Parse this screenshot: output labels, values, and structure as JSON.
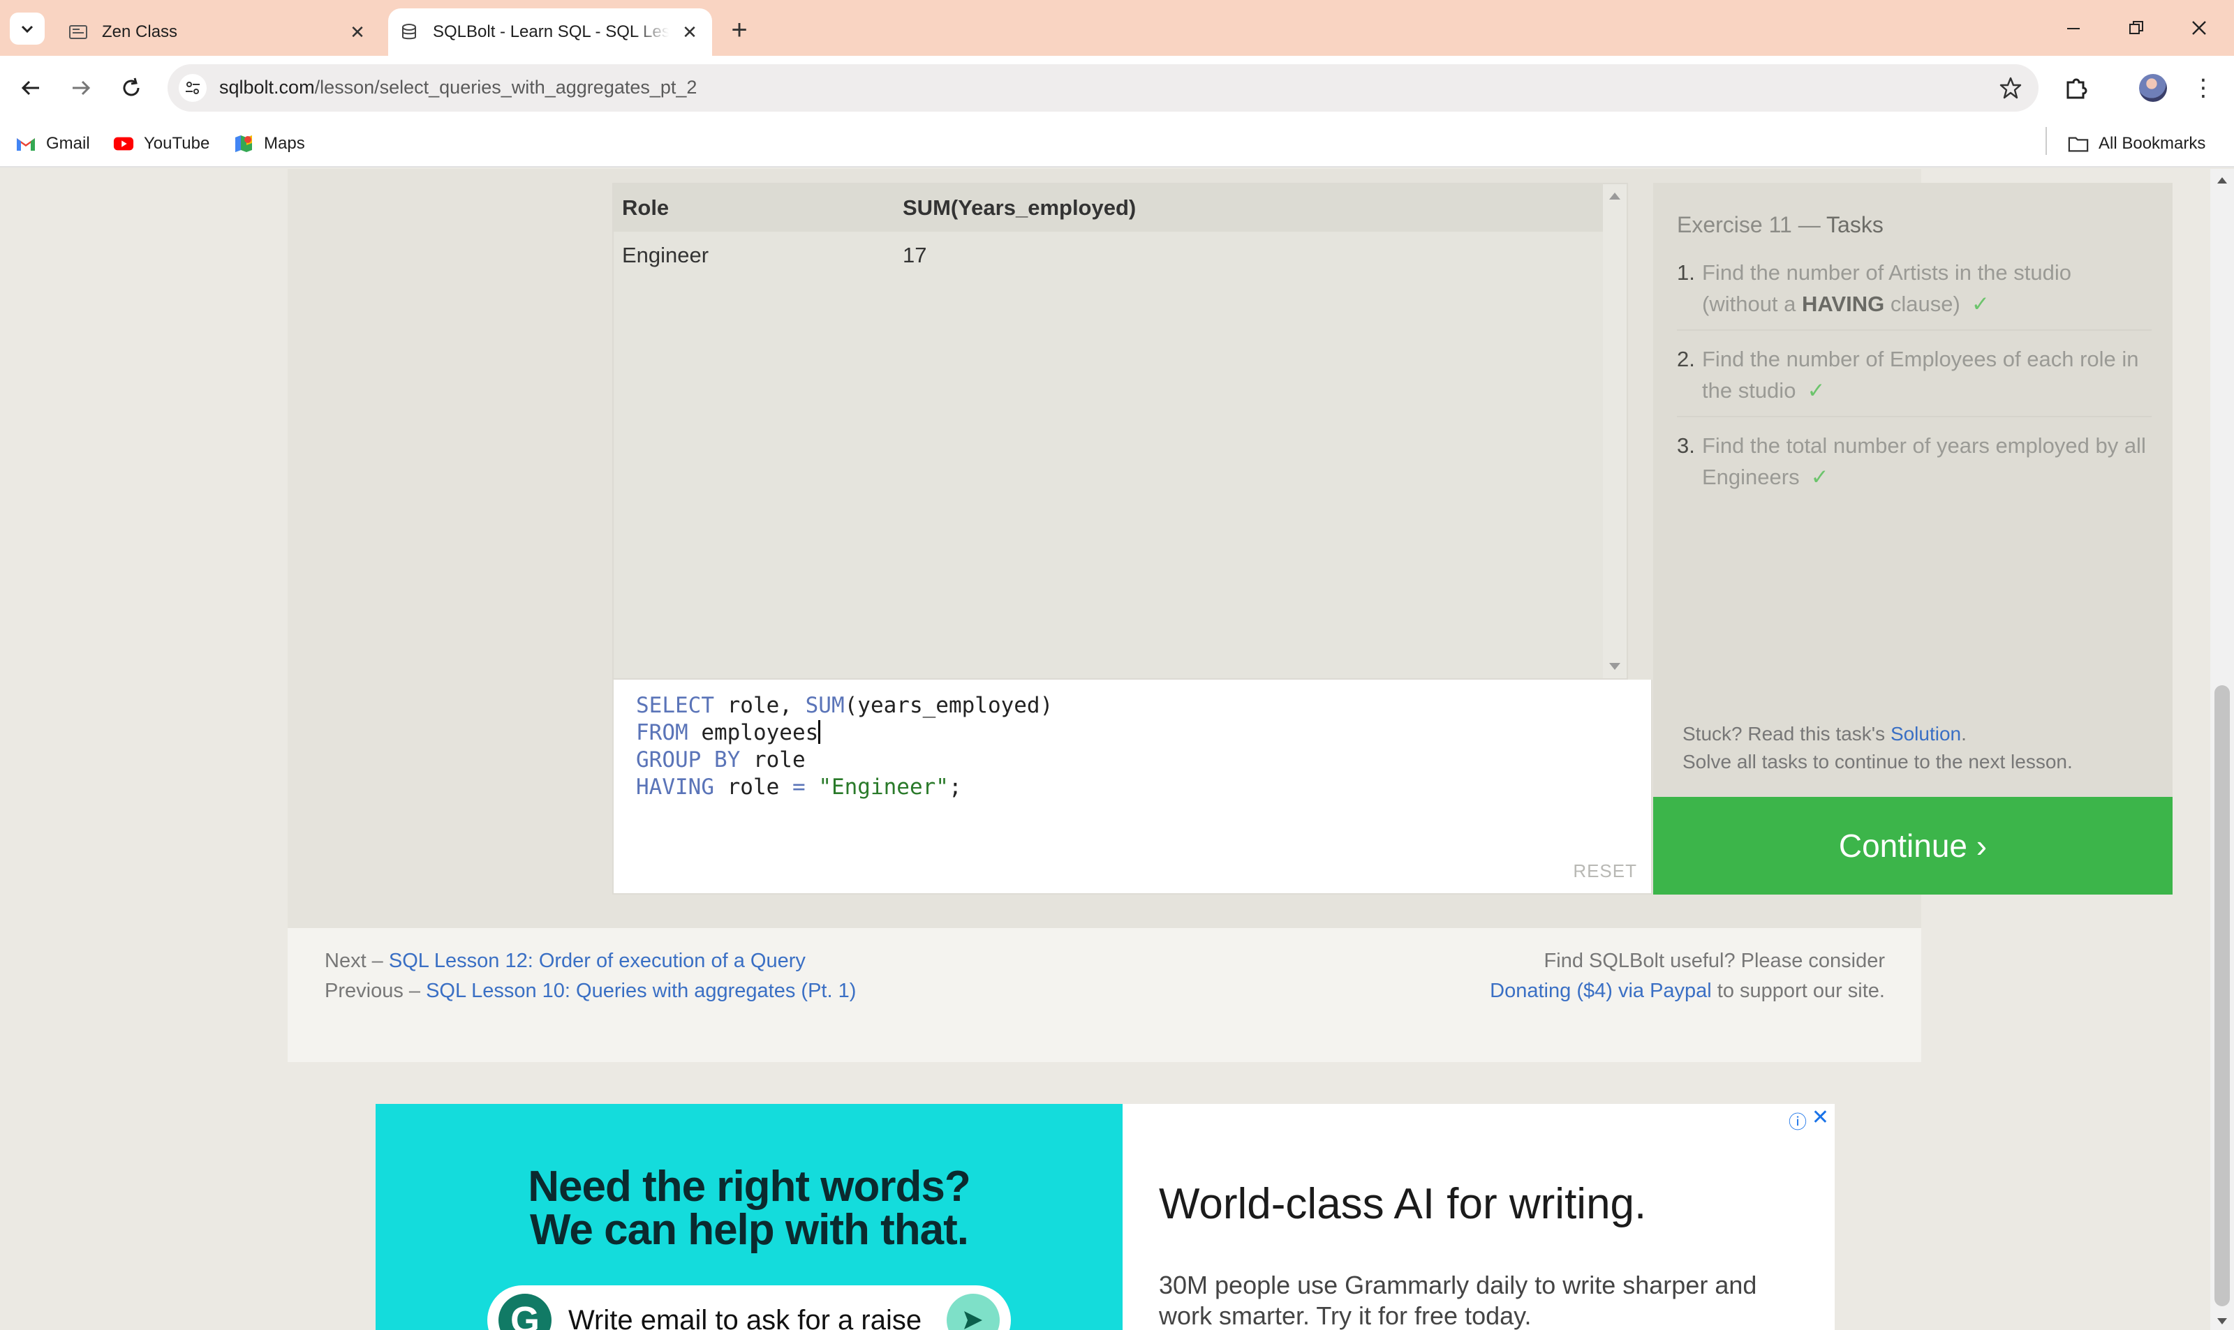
{
  "browser": {
    "tabs": [
      {
        "title": "Zen Class",
        "favicon": "zen-class-favicon"
      },
      {
        "title": "SQLBolt - Learn SQL - SQL Lessons",
        "favicon": "database-favicon",
        "active": true
      }
    ],
    "url_host": "sqlbolt.com",
    "url_path": "/lesson/select_queries_with_aggregates_pt_2",
    "bookmarks": [
      {
        "label": "Gmail",
        "icon": "gmail-icon"
      },
      {
        "label": "YouTube",
        "icon": "youtube-icon"
      },
      {
        "label": "Maps",
        "icon": "maps-icon"
      }
    ],
    "all_bookmarks_label": "All Bookmarks"
  },
  "results": {
    "columns": [
      "Role",
      "SUM(Years_employed)"
    ],
    "rows": [
      [
        "Engineer",
        "17"
      ]
    ]
  },
  "editor": {
    "lines": [
      [
        {
          "t": "kw",
          "v": "SELECT"
        },
        {
          "t": "plain",
          "v": " role, "
        },
        {
          "t": "kw",
          "v": "SUM"
        },
        {
          "t": "plain",
          "v": "(years_employed)"
        }
      ],
      [
        {
          "t": "kw",
          "v": "FROM"
        },
        {
          "t": "plain",
          "v": " employees"
        },
        {
          "t": "caret",
          "v": ""
        }
      ],
      [
        {
          "t": "kw",
          "v": "GROUP BY"
        },
        {
          "t": "plain",
          "v": " role"
        }
      ],
      [
        {
          "t": "kw",
          "v": "HAVING"
        },
        {
          "t": "plain",
          "v": " role "
        },
        {
          "t": "op",
          "v": "="
        },
        {
          "t": "plain",
          "v": " "
        },
        {
          "t": "str",
          "v": "\"Engineer\""
        },
        {
          "t": "plain",
          "v": ";"
        }
      ]
    ],
    "reset_label": "RESET"
  },
  "tasks": {
    "heading_prefix": "Exercise 11 —",
    "heading_em": "Tasks",
    "items": [
      {
        "num": "1.",
        "parts": [
          "Find the number of Artists in the studio (without a ",
          "HAVING",
          " clause)"
        ],
        "done": true
      },
      {
        "num": "2.",
        "parts": [
          "Find the number of Employees of each role in the studio"
        ],
        "done": true
      },
      {
        "num": "3.",
        "parts": [
          "Find the total number of years employed by all Engineers"
        ],
        "done": true
      }
    ],
    "check_mark": "✓",
    "hint_prefix": "Stuck? Read this task's ",
    "hint_link": "Solution",
    "hint_suffix": ".",
    "hint_line2": "Solve all tasks to continue to the next lesson."
  },
  "continue_label": "Continue ›",
  "lesson_nav": {
    "next_prefix": "Next – ",
    "next_link": "SQL Lesson 12: Order of execution of a Query",
    "prev_prefix": "Previous – ",
    "prev_link": "SQL Lesson 10: Queries with aggregates (Pt. 1)",
    "donate_line1": "Find SQLBolt useful? Please consider",
    "donate_link": "Donating ($4) via Paypal",
    "donate_suffix": " to support our site."
  },
  "ad": {
    "headline_line1": "Need the right words?",
    "headline_line2": "We can help with that.",
    "pill_text": "Write email to ask for a raise",
    "title": "World-class AI for writing.",
    "subtitle": "30M people use Grammarly daily to write sharper and work smarter. Try it for free today.",
    "logo_letter": "G"
  },
  "colors": {
    "accent_green": "#3cb54a",
    "link_blue": "#3a6fc4",
    "tabstrip": "#f9d4c2",
    "ad_cyan": "#14dcdc"
  }
}
